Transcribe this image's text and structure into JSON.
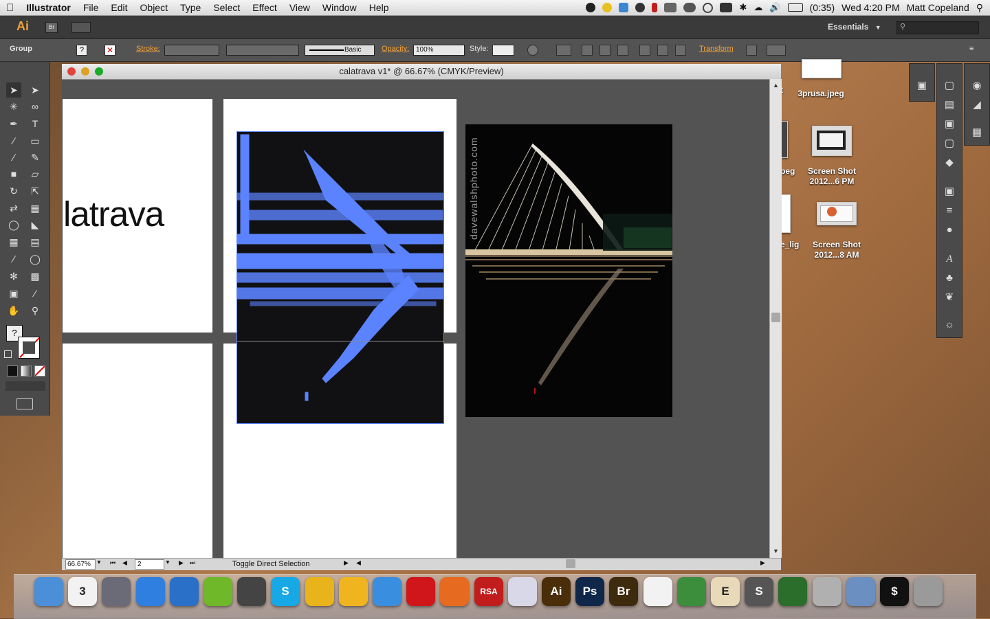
{
  "menubar": {
    "app": "Illustrator",
    "items": [
      "File",
      "Edit",
      "Object",
      "Type",
      "Select",
      "Effect",
      "View",
      "Window",
      "Help"
    ],
    "battery": "(0:35)",
    "clock": "Wed 4:20 PM",
    "user": "Matt Copeland"
  },
  "appbar": {
    "ai_label": "Ai",
    "br_label": "Br",
    "workspace": "Essentials"
  },
  "control": {
    "selection": "Group",
    "stroke_label": "Stroke:",
    "brush": "Basic",
    "opacity_label": "Opacity:",
    "opacity_value": "100%",
    "style_label": "Style:",
    "transform_label": "Transform"
  },
  "document": {
    "title": "calatrava v1* @ 66.67% (CMYK/Preview)",
    "artboard_text": "latrava",
    "watermark": "davewalshphoto.com",
    "zoom": "66.67%",
    "artboard_number": "2",
    "status": "Toggle Direct Selection"
  },
  "desktop": {
    "items": [
      {
        "label": "3prusa.jpeg"
      },
      {
        "label": "Screen Shot\n2012...6 PM"
      },
      {
        "label": "Screen Shot\n2012...8 AM"
      }
    ],
    "partial": [
      "t",
      "M",
      "peg",
      "e_lig",
      "g"
    ]
  },
  "dock": {
    "items": [
      {
        "name": "finder",
        "label": "",
        "color": "#4a8fd8"
      },
      {
        "name": "ical",
        "label": "3",
        "color": "#f2f2f2"
      },
      {
        "name": "launchpad",
        "label": "",
        "color": "#6b6b78"
      },
      {
        "name": "app-store",
        "label": "",
        "color": "#2f7fe0"
      },
      {
        "name": "itunes",
        "label": "",
        "color": "#2a70c8"
      },
      {
        "name": "spotify",
        "label": "",
        "color": "#6fb82a"
      },
      {
        "name": "steam",
        "label": "",
        "color": "#444"
      },
      {
        "name": "skype",
        "label": "S",
        "color": "#17a8e6"
      },
      {
        "name": "chrome",
        "label": "",
        "color": "#e8b31b"
      },
      {
        "name": "chrome-canary",
        "label": "",
        "color": "#f0b51e"
      },
      {
        "name": "safari",
        "label": "",
        "color": "#3a8ee0"
      },
      {
        "name": "opera",
        "label": "",
        "color": "#d0151b"
      },
      {
        "name": "firefox",
        "label": "",
        "color": "#e66a1f"
      },
      {
        "name": "rsa-securid",
        "label": "RSA",
        "color": "#c21d1d"
      },
      {
        "name": "preview",
        "label": "",
        "color": "#d8d8e8"
      },
      {
        "name": "illustrator",
        "label": "Ai",
        "color": "#4a2e0a"
      },
      {
        "name": "photoshop",
        "label": "Ps",
        "color": "#0f2748"
      },
      {
        "name": "bridge",
        "label": "Br",
        "color": "#3e2a0c"
      },
      {
        "name": "acrobat",
        "label": "",
        "color": "#f2f2f2"
      },
      {
        "name": "sourcetree",
        "label": "",
        "color": "#3c8e3c"
      },
      {
        "name": "coffee",
        "label": "E",
        "color": "#e8d9b8"
      },
      {
        "name": "sublime",
        "label": "S",
        "color": "#555"
      },
      {
        "name": "vim",
        "label": "",
        "color": "#2b6d2b"
      },
      {
        "name": "disk-utility",
        "label": "",
        "color": "#b0b0b0"
      },
      {
        "name": "xcode",
        "label": "",
        "color": "#6a8fc0"
      },
      {
        "name": "terminal",
        "label": "$",
        "color": "#111"
      },
      {
        "name": "trash",
        "label": "",
        "color": "#9a9a9a"
      }
    ]
  },
  "colors": {
    "selection": "#5b83ff",
    "ui_dark": "#535353",
    "orange_label": "#f4a236"
  }
}
